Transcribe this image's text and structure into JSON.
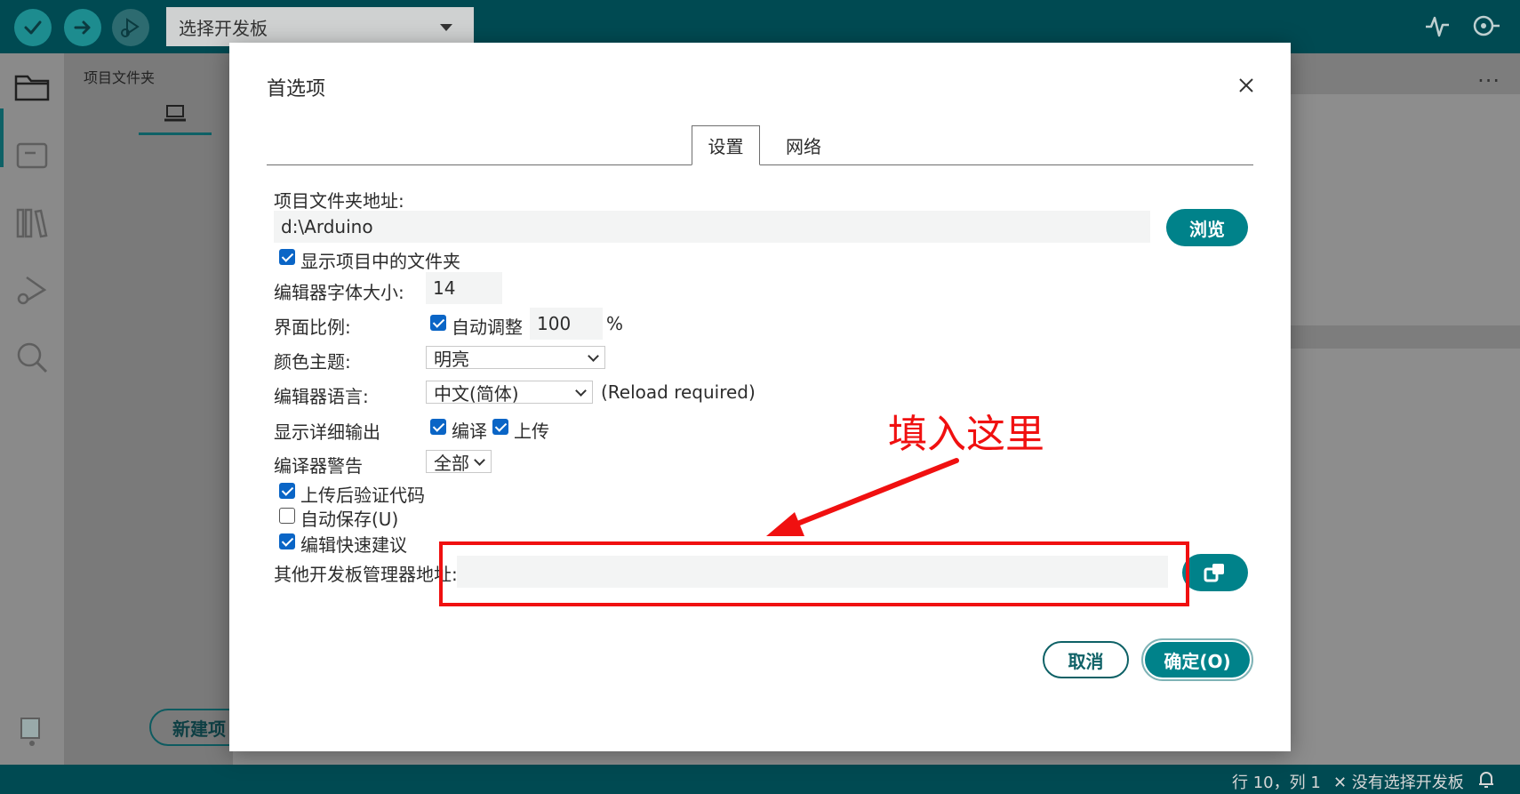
{
  "toolbar": {
    "verify_icon": "checkmark-icon",
    "upload_icon": "arrow-right-icon",
    "debug_icon": "debug-play-icon",
    "board_select": "选择开发板",
    "serial_plotter_icon": "pulse-icon",
    "serial_monitor_icon": "monitor-icon"
  },
  "sidebar": {
    "icons": [
      "folder-icon",
      "board-icon",
      "library-icon",
      "debug-icon",
      "search-icon",
      "profile-icon"
    ]
  },
  "explorer": {
    "title": "项目文件夹",
    "new_project": "新建项"
  },
  "editor": {
    "more": "..."
  },
  "status": {
    "position": "行 10，列 1",
    "board": "✕ 没有选择开发板"
  },
  "dialog": {
    "title": "首选项",
    "tabs": [
      {
        "label": "设置",
        "active": true
      },
      {
        "label": "网络",
        "active": false
      }
    ],
    "sketchbook": {
      "label": "项目文件夹地址:",
      "value": "d:\\Arduino",
      "browse": "浏览"
    },
    "show_files": {
      "label": "显示项目中的文件夹",
      "checked": true
    },
    "font_size": {
      "label": "编辑器字体大小:",
      "value": "14"
    },
    "scale": {
      "label": "界面比例:",
      "auto_label": "自动调整",
      "auto_checked": true,
      "value": "100",
      "unit": "%"
    },
    "theme": {
      "label": "颜色主题:",
      "value": "明亮"
    },
    "language": {
      "label": "编辑器语言:",
      "value": "中文(简体)",
      "note": "(Reload required)"
    },
    "verbose": {
      "label": "显示详细输出",
      "compile_label": "编译",
      "compile_checked": true,
      "upload_label": "上传",
      "upload_checked": true
    },
    "warnings": {
      "label": "编译器警告",
      "value": "全部"
    },
    "verify_after_upload": {
      "label": "上传后验证代码",
      "checked": true
    },
    "auto_save": {
      "label": "自动保存(U)",
      "checked": false
    },
    "quick_suggestions": {
      "label": "编辑快速建议",
      "checked": true
    },
    "board_urls": {
      "label": "其他开发板管理器地址:",
      "value": ""
    },
    "cancel": "取消",
    "ok": "确定(O)"
  },
  "annotation": {
    "text": "填入这里",
    "color": "#f01010"
  },
  "colors": {
    "teal": "#00828a",
    "header": "#004a52",
    "checkbox": "#0a65c6"
  }
}
